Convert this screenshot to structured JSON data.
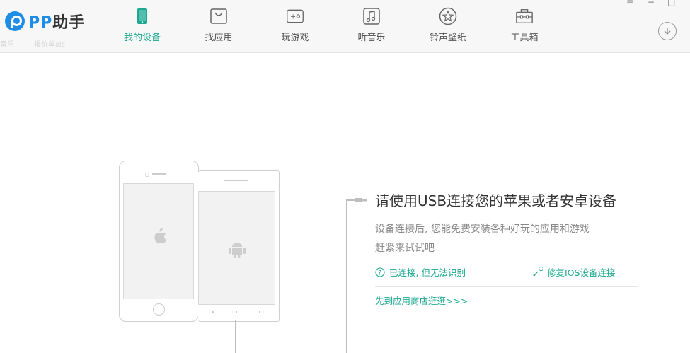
{
  "app": {
    "logo_text": "PP",
    "logo_cn": "助手",
    "brand_color": "#1f8de6",
    "accent_color": "#1aa98f"
  },
  "desktop_ghost": {
    "left": "音乐",
    "right": "报价单xls"
  },
  "nav": [
    {
      "label": "我的设备",
      "icon": "tablet-icon",
      "active": true
    },
    {
      "label": "找应用",
      "icon": "bag-icon",
      "active": false
    },
    {
      "label": "玩游戏",
      "icon": "gamepad-icon",
      "active": false
    },
    {
      "label": "听音乐",
      "icon": "music-note-icon",
      "active": false
    },
    {
      "label": "铃声壁纸",
      "icon": "star-icon",
      "active": false
    },
    {
      "label": "工具箱",
      "icon": "toolbox-icon",
      "active": false
    }
  ],
  "window_controls": {
    "menu": "≡",
    "min": "−",
    "max": "□"
  },
  "main": {
    "headline": "请使用USB连接您的苹果或者安卓设备",
    "desc_line1": "设备连接后, 您能免费安装各种好玩的应用和游戏",
    "desc_line2": "赶紧来试试吧",
    "link_connected": "已连接, 但无法识别",
    "link_repair": "修复IOS设备连接",
    "link_store": "先到应用商店逛逛>>>"
  }
}
